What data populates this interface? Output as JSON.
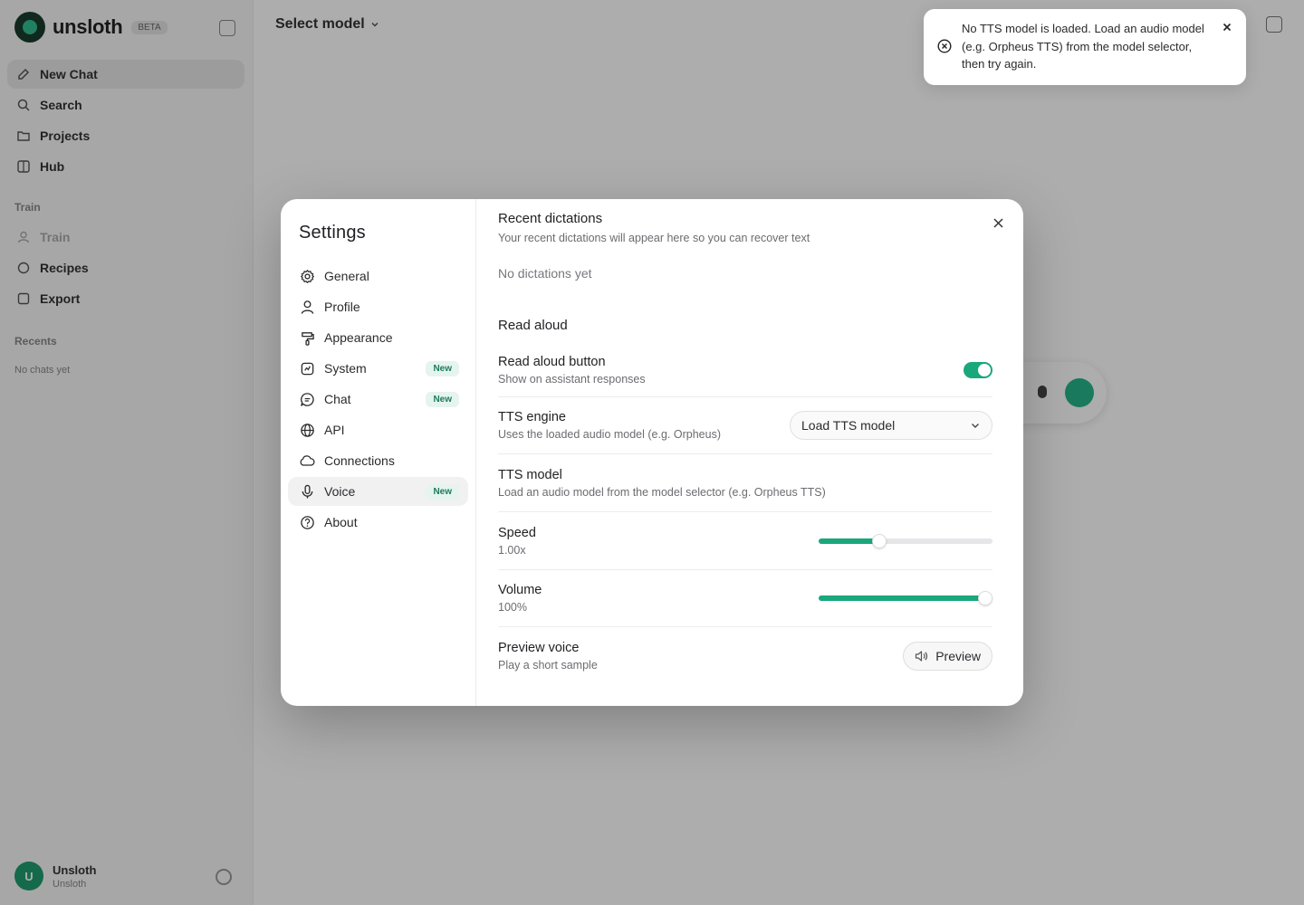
{
  "app": {
    "brand_name": "unsloth",
    "brand_tag": "BETA",
    "nav": [
      {
        "label": "New Chat",
        "icon": "new-chat-icon"
      },
      {
        "label": "Search",
        "icon": "search-icon"
      },
      {
        "label": "Projects",
        "icon": "folder-icon"
      },
      {
        "label": "Hub",
        "icon": "grid-icon"
      }
    ],
    "train_section": "Train",
    "train_nav": [
      {
        "label": "Train",
        "icon": "user-icon"
      },
      {
        "label": "Recipes",
        "icon": "recipes-icon"
      },
      {
        "label": "Export",
        "icon": "export-icon"
      }
    ],
    "recents_section": "Recents",
    "recents_empty": "No chats yet",
    "user": {
      "initial": "U",
      "name": "Unsloth",
      "sub": "Unsloth"
    },
    "model_select": "Select model"
  },
  "settings": {
    "title": "Settings",
    "nav": [
      {
        "label": "General",
        "icon": "gear-icon",
        "badge": ""
      },
      {
        "label": "Profile",
        "icon": "user-icon",
        "badge": ""
      },
      {
        "label": "Appearance",
        "icon": "paintbrush-icon",
        "badge": ""
      },
      {
        "label": "System",
        "icon": "cpu-icon",
        "badge": "New"
      },
      {
        "label": "Chat",
        "icon": "chat-icon",
        "badge": "New"
      },
      {
        "label": "API",
        "icon": "globe-icon",
        "badge": ""
      },
      {
        "label": "Connections",
        "icon": "cloud-icon",
        "badge": ""
      },
      {
        "label": "Voice",
        "icon": "mic-icon",
        "badge": "New",
        "active": true
      },
      {
        "label": "About",
        "icon": "help-icon",
        "badge": ""
      }
    ],
    "recent": {
      "title": "Recent dictations",
      "subtitle": "Your recent dictations will appear here so you can recover text",
      "empty": "No dictations yet"
    },
    "read_aloud": {
      "title": "Read aloud",
      "button_title": "Read aloud button",
      "button_desc": "Show on assistant responses",
      "button_enabled": true,
      "engine_title": "TTS engine",
      "engine_desc": "Uses the loaded audio model (e.g. Orpheus)",
      "engine_value": "Load TTS model",
      "model_title": "TTS model",
      "model_desc": "Load an audio model from the model selector (e.g. Orpheus TTS)",
      "speed_title": "Speed",
      "speed_value": "1.00x",
      "speed_fraction": 0.35,
      "volume_title": "Volume",
      "volume_value": "100%",
      "volume_fraction": 0.96,
      "preview_title": "Preview voice",
      "preview_desc": "Play a short sample",
      "preview_button": "Preview"
    }
  },
  "toast": {
    "message": "No TTS model is loaded. Load an audio model (e.g. Orpheus TTS) from the model selector, then try again."
  },
  "colors": {
    "accent": "#1aa77b",
    "badge_text": "#1d7a5c",
    "badge_bg": "#e5f4ee"
  }
}
